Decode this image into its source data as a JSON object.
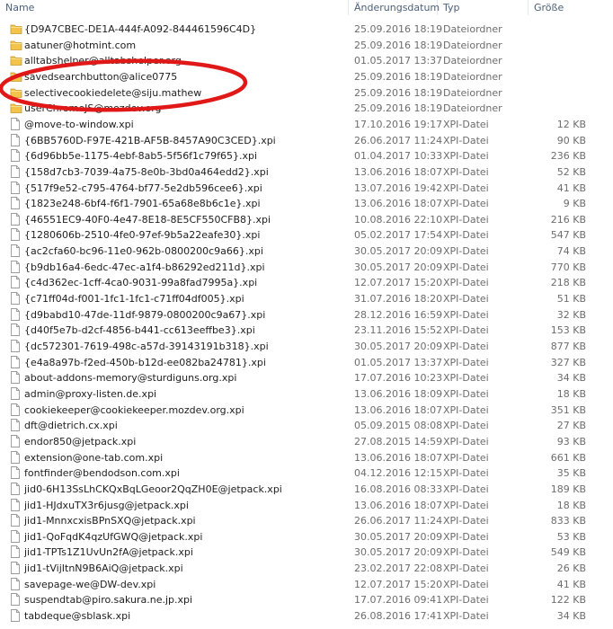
{
  "columns": {
    "name": "Name",
    "date": "Änderungsdatum",
    "type": "Typ",
    "size": "Größe"
  },
  "files": [
    {
      "name": "{D9A7CBEC-DE1A-444f-A092-844461596C4D}",
      "date": "25.09.2016 18:19",
      "type": "Dateiordner",
      "size": "",
      "icon": "folder-icon"
    },
    {
      "name": "aatuner@hotmint.com",
      "date": "25.09.2016 18:19",
      "type": "Dateiordner",
      "size": "",
      "icon": "folder-icon"
    },
    {
      "name": "alltabshelper@alltabshelper.org",
      "date": "01.05.2017 13:37",
      "type": "Dateiordner",
      "size": "",
      "icon": "folder-icon"
    },
    {
      "name": "savedsearchbutton@alice0775",
      "date": "25.09.2016 18:19",
      "type": "Dateiordner",
      "size": "",
      "icon": "folder-icon"
    },
    {
      "name": "selectivecookiedelete@siju.mathew",
      "date": "25.09.2016 18:19",
      "type": "Dateiordner",
      "size": "",
      "icon": "folder-icon"
    },
    {
      "name": "userChromeJS@mozdev.org",
      "date": "25.09.2016 18:19",
      "type": "Dateiordner",
      "size": "",
      "icon": "folder-icon"
    },
    {
      "name": "@move-to-window.xpi",
      "date": "17.10.2016 19:17",
      "type": "XPI-Datei",
      "size": "12 KB",
      "icon": "file-icon"
    },
    {
      "name": "{6BB5760D-F97E-421B-AF5B-8457A90C3CED}.xpi",
      "date": "26.06.2017 11:24",
      "type": "XPI-Datei",
      "size": "90 KB",
      "icon": "file-icon"
    },
    {
      "name": "{6d96bb5e-1175-4ebf-8ab5-5f56f1c79f65}.xpi",
      "date": "01.04.2017 10:33",
      "type": "XPI-Datei",
      "size": "236 KB",
      "icon": "file-icon"
    },
    {
      "name": "{158d7cb3-7039-4a75-8e0b-3bd0a464edd2}.xpi",
      "date": "13.06.2016 18:07",
      "type": "XPI-Datei",
      "size": "52 KB",
      "icon": "file-icon"
    },
    {
      "name": "{517f9e52-c795-4764-bf77-5e2db596cee6}.xpi",
      "date": "13.07.2016 19:42",
      "type": "XPI-Datei",
      "size": "41 KB",
      "icon": "file-icon"
    },
    {
      "name": "{1823e248-6bf4-f6f1-7901-65a68e8b6c1e}.xpi",
      "date": "13.06.2016 18:07",
      "type": "XPI-Datei",
      "size": "9 KB",
      "icon": "file-icon"
    },
    {
      "name": "{46551EC9-40F0-4e47-8E18-8E5CF550CFB8}.xpi",
      "date": "10.08.2016 22:10",
      "type": "XPI-Datei",
      "size": "216 KB",
      "icon": "file-icon"
    },
    {
      "name": "{1280606b-2510-4fe0-97ef-9b5a22eafe30}.xpi",
      "date": "05.02.2017 17:54",
      "type": "XPI-Datei",
      "size": "547 KB",
      "icon": "file-icon"
    },
    {
      "name": "{ac2cfa60-bc96-11e0-962b-0800200c9a66}.xpi",
      "date": "30.05.2017 20:09",
      "type": "XPI-Datei",
      "size": "74 KB",
      "icon": "file-icon"
    },
    {
      "name": "{b9db16a4-6edc-47ec-a1f4-b86292ed211d}.xpi",
      "date": "30.05.2017 20:09",
      "type": "XPI-Datei",
      "size": "770 KB",
      "icon": "file-icon"
    },
    {
      "name": "{c4d362ec-1cff-4ca0-9031-99a8fad7995a}.xpi",
      "date": "12.07.2017 15:20",
      "type": "XPI-Datei",
      "size": "218 KB",
      "icon": "file-icon"
    },
    {
      "name": "{c71ff04d-f001-1fc1-1fc1-c71ff04df005}.xpi",
      "date": "31.07.2016 18:20",
      "type": "XPI-Datei",
      "size": "51 KB",
      "icon": "file-icon"
    },
    {
      "name": "{d9babd10-47de-11df-9879-0800200c9a67}.xpi",
      "date": "28.12.2016 16:59",
      "type": "XPI-Datei",
      "size": "32 KB",
      "icon": "file-icon"
    },
    {
      "name": "{d40f5e7b-d2cf-4856-b441-cc613eeffbe3}.xpi",
      "date": "23.11.2016 15:52",
      "type": "XPI-Datei",
      "size": "153 KB",
      "icon": "file-icon"
    },
    {
      "name": "{dc572301-7619-498c-a57d-39143191b318}.xpi",
      "date": "30.05.2017 20:09",
      "type": "XPI-Datei",
      "size": "877 KB",
      "icon": "file-icon"
    },
    {
      "name": "{e4a8a97b-f2ed-450b-b12d-ee082ba24781}.xpi",
      "date": "01.05.2017 13:37",
      "type": "XPI-Datei",
      "size": "327 KB",
      "icon": "file-icon"
    },
    {
      "name": "about-addons-memory@sturdiguns.org.xpi",
      "date": "17.07.2016 10:23",
      "type": "XPI-Datei",
      "size": "34 KB",
      "icon": "file-icon"
    },
    {
      "name": "admin@proxy-listen.de.xpi",
      "date": "13.06.2016 18:09",
      "type": "XPI-Datei",
      "size": "18 KB",
      "icon": "file-icon"
    },
    {
      "name": "cookiekeeper@cookiekeeper.mozdev.org.xpi",
      "date": "13.06.2016 18:07",
      "type": "XPI-Datei",
      "size": "351 KB",
      "icon": "file-icon"
    },
    {
      "name": "dft@dietrich.cx.xpi",
      "date": "05.09.2015 08:08",
      "type": "XPI-Datei",
      "size": "27 KB",
      "icon": "file-icon"
    },
    {
      "name": "endor850@jetpack.xpi",
      "date": "27.08.2015 14:59",
      "type": "XPI-Datei",
      "size": "93 KB",
      "icon": "file-icon"
    },
    {
      "name": "extension@one-tab.com.xpi",
      "date": "13.06.2016 18:07",
      "type": "XPI-Datei",
      "size": "661 KB",
      "icon": "file-icon"
    },
    {
      "name": "fontfinder@bendodson.com.xpi",
      "date": "04.12.2016 12:15",
      "type": "XPI-Datei",
      "size": "35 KB",
      "icon": "file-icon"
    },
    {
      "name": "jid0-6H13SsLhCKQxBqLGeoor2QqZH0E@jetpack.xpi",
      "date": "16.08.2016 08:33",
      "type": "XPI-Datei",
      "size": "189 KB",
      "icon": "file-icon"
    },
    {
      "name": "jid1-HJdxuTX3r6jusg@jetpack.xpi",
      "date": "13.06.2016 18:07",
      "type": "XPI-Datei",
      "size": "18 KB",
      "icon": "file-icon"
    },
    {
      "name": "jid1-MnnxcxisBPnSXQ@jetpack.xpi",
      "date": "26.06.2017 11:24",
      "type": "XPI-Datei",
      "size": "833 KB",
      "icon": "file-icon"
    },
    {
      "name": "jid1-QoFqdK4qzUfGWQ@jetpack.xpi",
      "date": "30.05.2017 20:09",
      "type": "XPI-Datei",
      "size": "53 KB",
      "icon": "file-icon"
    },
    {
      "name": "jid1-TPTs1Z1UvUn2fA@jetpack.xpi",
      "date": "30.05.2017 20:09",
      "type": "XPI-Datei",
      "size": "549 KB",
      "icon": "file-icon"
    },
    {
      "name": "jid1-tVijItnN9B6AiQ@jetpack.xpi",
      "date": "23.02.2017 22:08",
      "type": "XPI-Datei",
      "size": "26 KB",
      "icon": "file-icon"
    },
    {
      "name": "savepage-we@DW-dev.xpi",
      "date": "12.07.2017 15:20",
      "type": "XPI-Datei",
      "size": "41 KB",
      "icon": "file-icon"
    },
    {
      "name": "suspendtab@piro.sakura.ne.jp.xpi",
      "date": "17.07.2016 09:41",
      "type": "XPI-Datei",
      "size": "122 KB",
      "icon": "file-icon"
    },
    {
      "name": "tabdeque@sblask.xpi",
      "date": "26.08.2016 17:41",
      "type": "XPI-Datei",
      "size": "34 KB",
      "icon": "file-icon"
    }
  ],
  "colors": {
    "header_text": "#4c607a",
    "folder_yellow": "#f3c44a",
    "annotation_red": "#e01818"
  }
}
